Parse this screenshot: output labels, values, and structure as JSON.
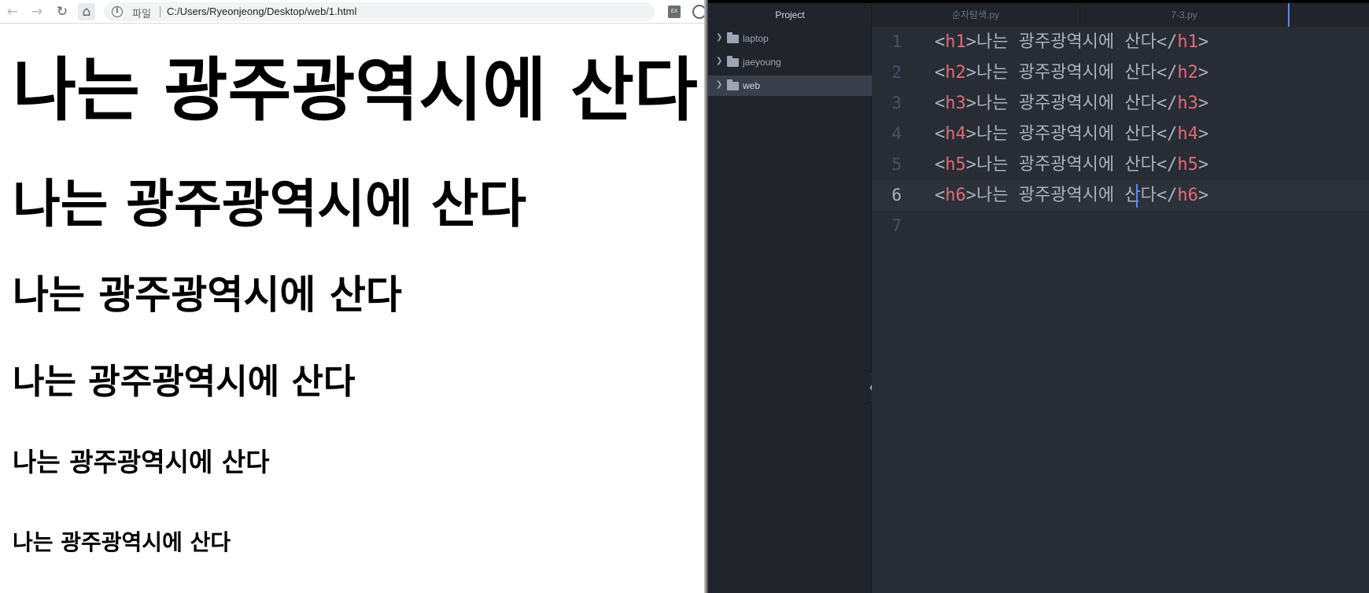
{
  "browser": {
    "scheme_label": "파일",
    "url": "C:/Users/Ryeonjeong/Desktop/web/1.html",
    "ext_label": "EX",
    "headings": [
      "나는 광주광역시에 산다",
      "나는 광주광역시에 산다",
      "나는 광주광역시에 산다",
      "나는 광주광역시에 산다",
      "나는 광주광역시에 산다",
      "나는 광주광역시에 산다"
    ]
  },
  "editor": {
    "tree_title": "Project",
    "tree_items": [
      "laptop",
      "jaeyoung",
      "web"
    ],
    "selected_tree_item": "web",
    "tabs": [
      "순자탐색.py",
      "7-3.py"
    ],
    "lines": [
      {
        "num": "1",
        "open": "<h1>",
        "text": "나는 광주광역시에 산다",
        "close": "</h1>"
      },
      {
        "num": "2",
        "open": "<h2>",
        "text": "나는 광주광역시에 산다",
        "close": "</h2>"
      },
      {
        "num": "3",
        "open": "<h3>",
        "text": "나는 광주광역시에 산다",
        "close": "</h3>"
      },
      {
        "num": "4",
        "open": "<h4>",
        "text": "나는 광주광역시에 산다",
        "close": "</h4>"
      },
      {
        "num": "5",
        "open": "<h5>",
        "text": "나는 광주광역시에 산다",
        "close": "</h5>"
      },
      {
        "num": "6",
        "open": "<h6>",
        "text": "나는 광주광역시에 산다",
        "close": "</h6>"
      },
      {
        "num": "7",
        "open": "",
        "text": "",
        "close": ""
      }
    ],
    "colors": {
      "background": "#282c34",
      "tag": "#e06c75",
      "text": "#abb2bf",
      "cursor": "#528bff"
    }
  }
}
